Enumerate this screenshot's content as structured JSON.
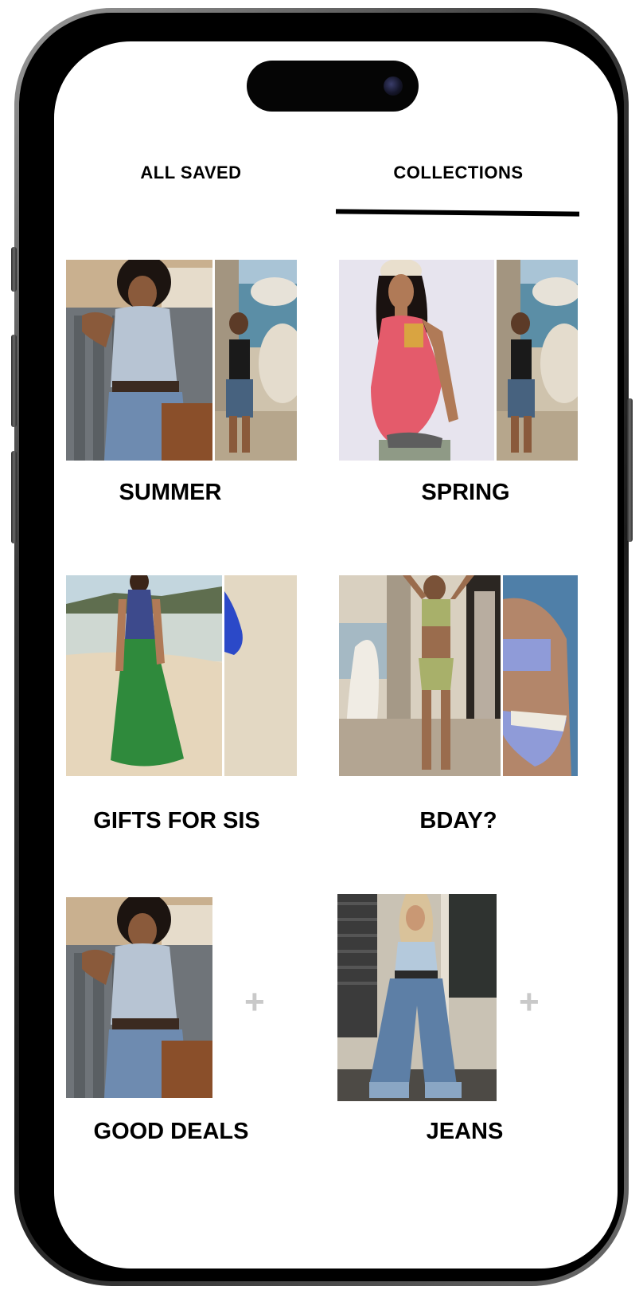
{
  "tabs": {
    "all_saved": "ALL SAVED",
    "collections": "COLLECTIONS",
    "active": "collections"
  },
  "collections": [
    {
      "title": "SUMMER",
      "images": [
        "woman-silver-cowl-top-denim-skirt",
        "woman-black-tank-jorts-beach-rocks"
      ]
    },
    {
      "title": "SPRING",
      "images": [
        "woman-pink-tank-knit-beanie",
        "woman-black-tank-jorts-beach-rocks"
      ]
    },
    {
      "title": "GIFTS FOR SIS",
      "images": [
        "woman-green-maxi-dress-beach",
        "blue-sleeve-beige-backdrop"
      ]
    },
    {
      "title": "BDAY?",
      "images": [
        "woman-green-bikini-surfboard",
        "blue-white-bikini-ocean"
      ]
    },
    {
      "title": "GOOD DEALS",
      "images": [
        "woman-silver-cowl-top-denim-skirt"
      ],
      "add_symbol": "+"
    },
    {
      "title": "JEANS",
      "images": [
        "woman-wide-leg-jeans-street"
      ],
      "add_symbol": "+"
    }
  ],
  "colors": {
    "text": "#000000",
    "add_symbol": "#c9c9c9",
    "background": "#ffffff"
  }
}
